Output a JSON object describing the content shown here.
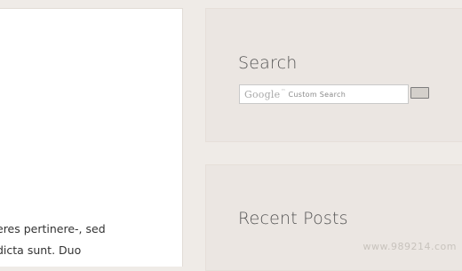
{
  "content": {
    "lines": [
      "eres pertinere-, sed",
      "dicta sunt. Duo",
      ""
    ]
  },
  "search_widget": {
    "title": "Search",
    "input_logo": "Google",
    "input_logo_mark": "™",
    "input_placeholder": "Custom Search"
  },
  "recent_widget": {
    "title": "Recent Posts"
  },
  "watermark": "www.989214.com",
  "colors": {
    "page_bg": "#efebe7",
    "widget_bg": "#ebe6e2",
    "card_bg": "#ffffff"
  }
}
